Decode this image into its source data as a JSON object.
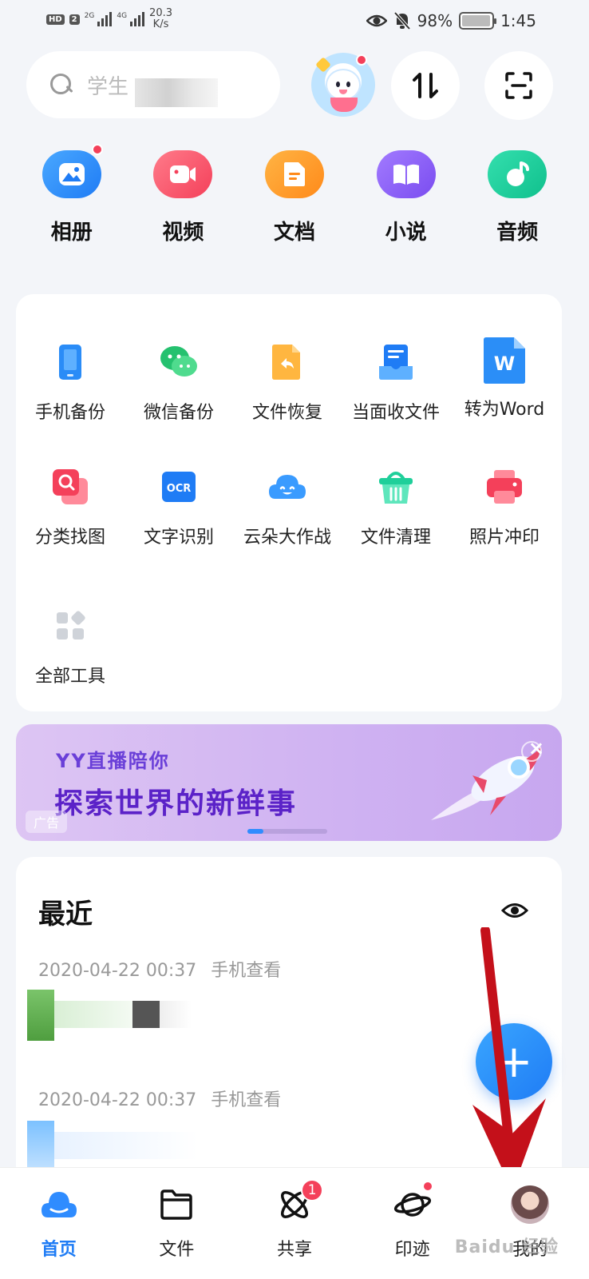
{
  "status_bar": {
    "hd_label": "HD",
    "sim_number": "2",
    "net1": "2G",
    "net2": "4G",
    "speed_value": "20.3",
    "speed_unit": "K/s",
    "battery_percent": "98%",
    "battery_level": 0.98,
    "time": "1:45"
  },
  "search": {
    "placeholder": "学生"
  },
  "header_buttons": {
    "transfer_glyph": "⇅",
    "scan_glyph": "⛶"
  },
  "categories": [
    {
      "label": "相册",
      "color": "#2f8cff"
    },
    {
      "label": "视频",
      "color": "#ff5b6e"
    },
    {
      "label": "文档",
      "color": "#ff9a1f"
    },
    {
      "label": "小说",
      "color": "#8a5cf6"
    },
    {
      "label": "音频",
      "color": "#1fcf9a"
    }
  ],
  "tools": [
    {
      "label": "手机备份"
    },
    {
      "label": "微信备份"
    },
    {
      "label": "文件恢复"
    },
    {
      "label": "当面收文件"
    },
    {
      "label": "转为Word"
    },
    {
      "label": "分类找图"
    },
    {
      "label": "文字识别"
    },
    {
      "label": "云朵大作战"
    },
    {
      "label": "文件清理"
    },
    {
      "label": "照片冲印"
    },
    {
      "label": "全部工具"
    }
  ],
  "ocr_text": "OCR",
  "word_letter": "W",
  "banner": {
    "subtitle": "YY直播陪你",
    "title": "探索世界的新鲜事",
    "ad_label": "广告",
    "close": "×"
  },
  "recent": {
    "title": "最近",
    "items": [
      {
        "date": "2020-04-22 00:37",
        "source": "手机查看"
      },
      {
        "date": "2020-04-22 00:37",
        "source": "手机查看"
      }
    ]
  },
  "fab_label": "+",
  "bottom_nav": [
    {
      "label": "首页",
      "active": true
    },
    {
      "label": "文件"
    },
    {
      "label": "共享",
      "badge": "1"
    },
    {
      "label": "印迹"
    },
    {
      "label": "我的"
    }
  ],
  "watermark": "Baidu 经验"
}
